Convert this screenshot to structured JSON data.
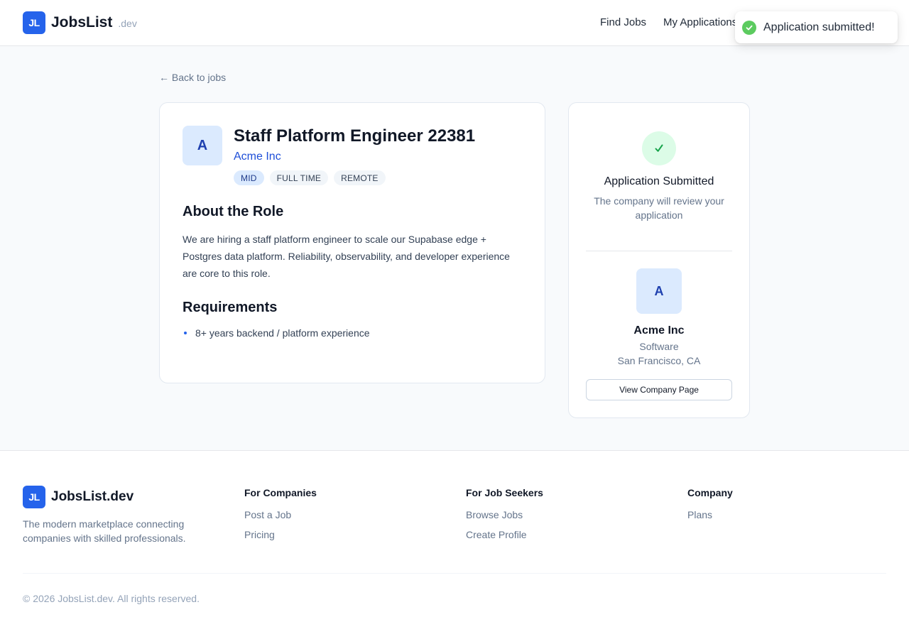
{
  "header": {
    "logo_initials": "JL",
    "brand_name": "JobsList",
    "brand_suffix": ".dev",
    "nav": [
      "Find Jobs",
      "My Applications"
    ]
  },
  "toast": {
    "message": "Application submitted!",
    "icon": "check-circle-icon",
    "color": "#5ccb5f"
  },
  "back_link": "← Back to jobs",
  "job": {
    "avatar_letter": "A",
    "title": "Staff Platform Engineer 22381",
    "company": "Acme Inc",
    "tags": [
      "MID",
      "FULL TIME",
      "REMOTE"
    ],
    "about_heading": "About the Role",
    "description": "We are hiring a staff platform engineer to scale our Supabase edge + Postgres data platform. Reliability, observability, and developer experience are core to this role.",
    "requirements_heading": "Requirements",
    "requirements": [
      "8+ years backend / platform experience"
    ]
  },
  "status_card": {
    "check_icon": "check-icon",
    "title": "Application Submitted",
    "subtitle": "The company will review your application"
  },
  "company_card": {
    "avatar_letter": "A",
    "name": "Acme Inc",
    "industry": "Software",
    "location": "San Francisco, CA",
    "button_label": "View Company Page"
  },
  "footer": {
    "logo_initials": "JL",
    "brand_name": "JobsList.dev",
    "tagline": "The modern marketplace connecting companies with skilled professionals.",
    "columns": [
      {
        "heading": "For Companies",
        "links": [
          "Post a Job",
          "Pricing"
        ]
      },
      {
        "heading": "For Job Seekers",
        "links": [
          "Browse Jobs",
          "Create Profile"
        ]
      },
      {
        "heading": "Company",
        "links": [
          "Plans"
        ]
      }
    ],
    "copyright": "© 2026 JobsList.dev. All rights reserved."
  },
  "colors": {
    "brand": "#2563eb",
    "company_link": "#1d4ed8",
    "success_bg": "#dcfce7",
    "success_fg": "#16a34a"
  }
}
